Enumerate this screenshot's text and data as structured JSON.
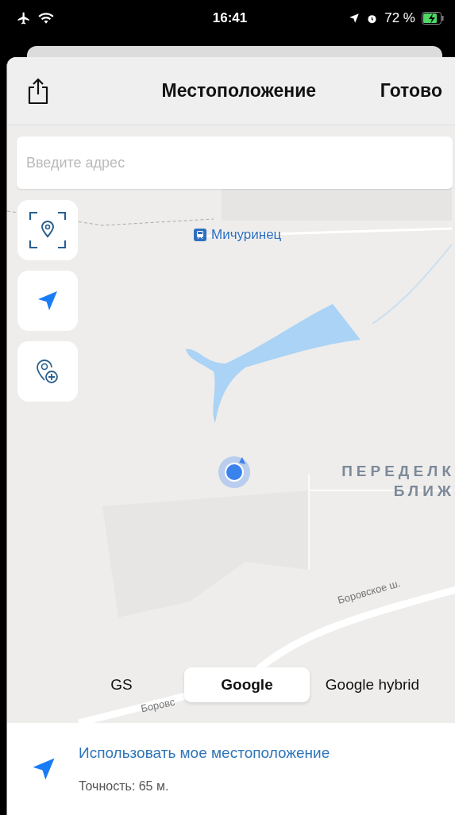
{
  "status_bar": {
    "time": "16:41",
    "battery": "72 %"
  },
  "header": {
    "title": "Местоположение",
    "done": "Готово"
  },
  "search": {
    "placeholder": "Введите адрес"
  },
  "map": {
    "labels": [
      {
        "kind": "station",
        "text": "Мичуринец"
      },
      {
        "kind": "district",
        "text": "ПЕРЕДЕЛК"
      },
      {
        "kind": "district2",
        "text": "БЛИЖ"
      },
      {
        "kind": "road",
        "text": "Боровское ш."
      },
      {
        "kind": "road2",
        "text": "Боровс"
      }
    ]
  },
  "map_types": [
    {
      "label": "GS",
      "selected": false
    },
    {
      "label": "Google",
      "selected": true
    },
    {
      "label": "Google hybrid",
      "selected": false
    }
  ],
  "bottom": {
    "action": "Использовать мое местоположение",
    "accuracy": "Точность: 65 м."
  }
}
